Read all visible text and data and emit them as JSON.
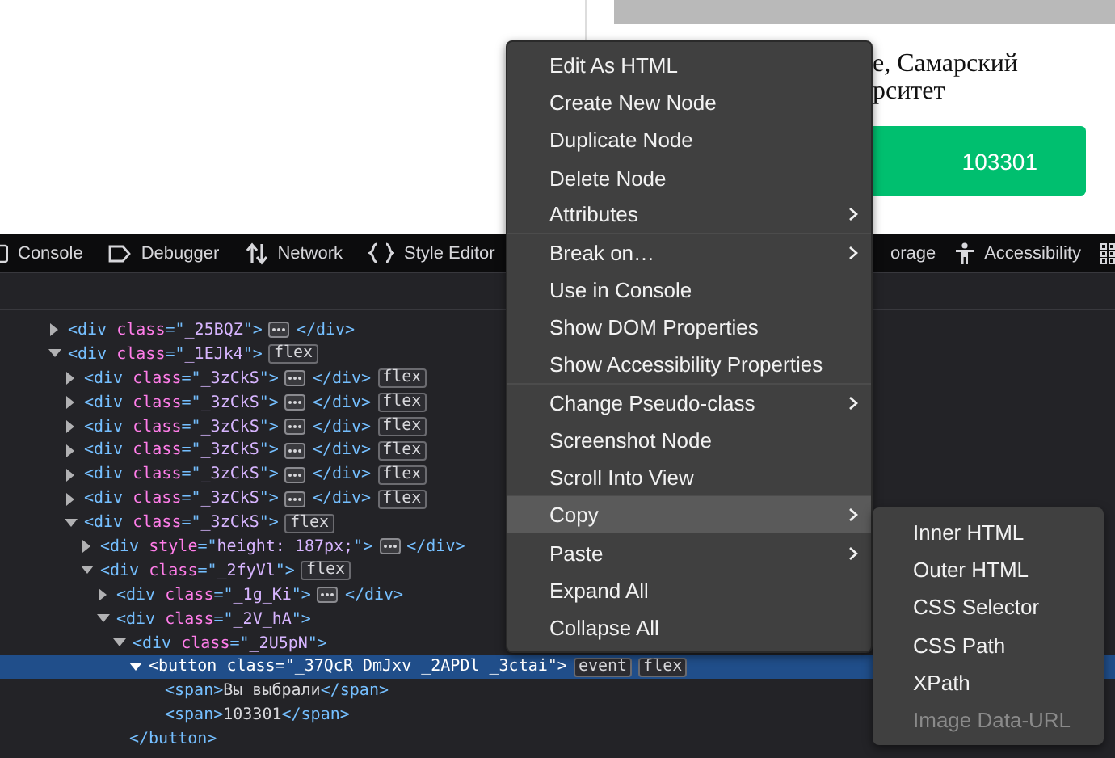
{
  "page": {
    "card_text": [
      "е, Самарский",
      "рситет"
    ],
    "card_button": "103301"
  },
  "toolbar": {
    "tabs": [
      {
        "label": "Console",
        "kind": "console"
      },
      {
        "label": "Debugger",
        "kind": "debugger"
      },
      {
        "label": "Network",
        "kind": "network"
      },
      {
        "label": "Style Editor",
        "kind": "style"
      }
    ],
    "right_tabs": [
      {
        "label": "orage",
        "kind": "none"
      },
      {
        "label": "Accessibility",
        "kind": "accessibility"
      }
    ]
  },
  "tree": [
    {
      "kind": "element",
      "open_tag": "<div class=\"_25BQZ\">",
      "close_tag": "</div>",
      "expanded": false,
      "selected": false
    },
    {
      "kind": "element",
      "open_tag": "<div class=\"_1EJk4\">",
      "expanded": true,
      "selected": false,
      "badges": [
        "flex"
      ],
      "children": [
        {
          "kind": "element",
          "open_tag": "<div class=\"_3zCkS\">",
          "close_tag": "</div>",
          "expanded": false,
          "selected": false,
          "badges": [
            "flex"
          ]
        },
        {
          "kind": "element",
          "open_tag": "<div class=\"_3zCkS\">",
          "close_tag": "</div>",
          "expanded": false,
          "selected": false,
          "badges": [
            "flex"
          ]
        },
        {
          "kind": "element",
          "open_tag": "<div class=\"_3zCkS\">",
          "close_tag": "</div>",
          "expanded": false,
          "selected": false,
          "badges": [
            "flex"
          ]
        },
        {
          "kind": "element",
          "open_tag": "<div class=\"_3zCkS\">",
          "close_tag": "</div>",
          "expanded": false,
          "selected": false,
          "badges": [
            "flex"
          ]
        },
        {
          "kind": "element",
          "open_tag": "<div class=\"_3zCkS\">",
          "close_tag": "</div>",
          "expanded": false,
          "selected": false,
          "badges": [
            "flex"
          ]
        },
        {
          "kind": "element",
          "open_tag": "<div class=\"_3zCkS\">",
          "close_tag": "</div>",
          "expanded": false,
          "selected": false,
          "badges": [
            "flex"
          ]
        },
        {
          "kind": "element",
          "open_tag": "<div class=\"_3zCkS\">",
          "expanded": true,
          "selected": false,
          "badges": [
            "flex"
          ],
          "children": [
            {
              "kind": "element",
              "open_tag": "<div style=\"height: 187px;\">",
              "close_tag": "</div>",
              "expanded": false,
              "selected": false
            },
            {
              "kind": "element",
              "open_tag": "<div class=\"_2fyVl\">",
              "expanded": true,
              "selected": false,
              "badges": [
                "flex"
              ],
              "children": [
                {
                  "kind": "element",
                  "open_tag": "<div class=\"_1g_Ki\">",
                  "close_tag": "</div>",
                  "expanded": false,
                  "selected": false
                },
                {
                  "kind": "element",
                  "open_tag": "<div class=\"_2V_hA\">",
                  "expanded": true,
                  "selected": false,
                  "children": [
                    {
                      "kind": "element",
                      "open_tag": "<div class=\"_2U5pN\">",
                      "expanded": true,
                      "selected": false,
                      "children": [
                        {
                          "kind": "element",
                          "open_tag": "<button class=\"_37QcR DmJxv _2APDl _3ctai\">",
                          "expanded": true,
                          "selected": true,
                          "badges": [
                            "event",
                            "flex"
                          ],
                          "children": [
                            {
                              "kind": "inline",
                              "text": "<span>Вы выбрали</span>",
                              "selected": false
                            },
                            {
                              "kind": "inline",
                              "text": "<span>103301</span>",
                              "selected": false
                            },
                            {
                              "kind": "close",
                              "text": "</button>",
                              "selected": false
                            }
                          ]
                        }
                      ]
                    }
                  ]
                }
              ]
            }
          ]
        }
      ]
    }
  ],
  "context_menu": {
    "items": [
      {
        "label": "Edit As HTML",
        "submenu": false,
        "highlighted": false,
        "separator_after": false
      },
      {
        "label": "Create New Node",
        "submenu": false,
        "highlighted": false,
        "separator_after": false
      },
      {
        "label": "Duplicate Node",
        "submenu": false,
        "highlighted": false,
        "separator_after": false
      },
      {
        "label": "Delete Node",
        "submenu": false,
        "highlighted": false,
        "separator_after": false
      },
      {
        "label": "Attributes",
        "submenu": true,
        "highlighted": false,
        "separator_after": true
      },
      {
        "label": "Break on…",
        "submenu": true,
        "highlighted": false,
        "separator_after": false
      },
      {
        "label": "Use in Console",
        "submenu": false,
        "highlighted": false,
        "separator_after": false
      },
      {
        "label": "Show DOM Properties",
        "submenu": false,
        "highlighted": false,
        "separator_after": false
      },
      {
        "label": "Show Accessibility Properties",
        "submenu": false,
        "highlighted": false,
        "separator_after": true
      },
      {
        "label": "Change Pseudo-class",
        "submenu": true,
        "highlighted": false,
        "separator_after": false
      },
      {
        "label": "Screenshot Node",
        "submenu": false,
        "highlighted": false,
        "separator_after": false
      },
      {
        "label": "Scroll Into View",
        "submenu": false,
        "highlighted": false,
        "separator_after": true
      },
      {
        "label": "Copy",
        "submenu": true,
        "highlighted": true,
        "separator_after": false
      },
      {
        "label": "Paste",
        "submenu": true,
        "highlighted": false,
        "separator_after": false
      },
      {
        "label": "Expand All",
        "submenu": false,
        "highlighted": false,
        "separator_after": false
      },
      {
        "label": "Collapse All",
        "submenu": false,
        "highlighted": false,
        "separator_after": false
      }
    ]
  },
  "copy_submenu": {
    "items": [
      {
        "label": "Inner HTML",
        "disabled": false
      },
      {
        "label": "Outer HTML",
        "disabled": false
      },
      {
        "label": "CSS Selector",
        "disabled": false
      },
      {
        "label": "CSS Path",
        "disabled": false
      },
      {
        "label": "XPath",
        "disabled": false
      },
      {
        "label": "Image Data-URL",
        "disabled": true
      }
    ]
  }
}
